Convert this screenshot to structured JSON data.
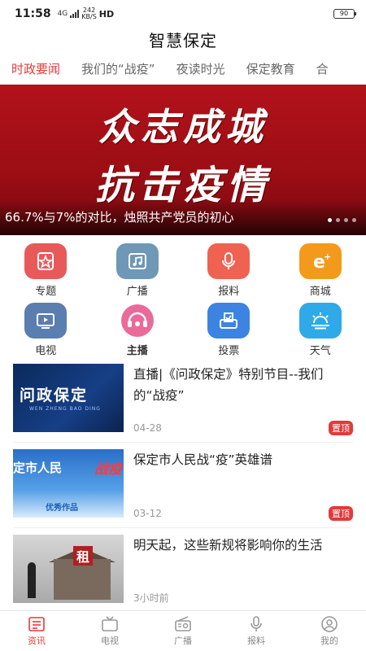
{
  "status_bar": {
    "time": "11:58",
    "network": "4G",
    "speed_value": "242",
    "speed_unit": "KB/S",
    "hd": "HD",
    "battery": "90"
  },
  "app": {
    "title": "智慧保定"
  },
  "tabs": [
    {
      "label": "时政要闻",
      "active": true
    },
    {
      "label": "我们的“战疫”"
    },
    {
      "label": "夜读时光"
    },
    {
      "label": "保定教育"
    },
    {
      "label": "合"
    }
  ],
  "banner": {
    "line1": "众志成城",
    "line2": "抗击疫情",
    "caption": "66.7%与7%的对比，烛照共产党员的初心"
  },
  "grid": [
    {
      "label": "专题",
      "icon": "star-doc-icon",
      "color": "#e85a5a"
    },
    {
      "label": "广播",
      "icon": "music-icon",
      "color": "#6f98b6"
    },
    {
      "label": "报料",
      "icon": "microphone-icon",
      "color": "#ef6252"
    },
    {
      "label": "商城",
      "icon": "e-shop-icon",
      "color": "#f39a1c"
    },
    {
      "label": "电视",
      "icon": "tv-icon",
      "color": "#5a7eb0"
    },
    {
      "label": "主播",
      "icon": "anchor-icon",
      "color": "#ea6a9a"
    },
    {
      "label": "投票",
      "icon": "vote-icon",
      "color": "#3d84e2"
    },
    {
      "label": "天气",
      "icon": "weather-icon",
      "color": "#2fa9e8"
    }
  ],
  "news": [
    {
      "title": "直播|《问政保定》特别节目--我们的“战疫”",
      "meta": "04-28",
      "pinned": "置顶",
      "thumb_big": "问政保定",
      "thumb_small": "WEN ZHENG BAO DING"
    },
    {
      "title": "保定市人民战“疫”英雄谱",
      "meta": "03-12",
      "pinned": "置顶",
      "thumb_a": "定市人民",
      "thumb_b": "战疫",
      "thumb_c": "优秀作品"
    },
    {
      "title": "明天起，这些新规将影响你的生活",
      "meta": "3小时前",
      "thumb_sign": "租"
    }
  ],
  "bottom_nav": [
    {
      "label": "资讯",
      "icon": "news-icon",
      "active": true
    },
    {
      "label": "电视",
      "icon": "tv-icon"
    },
    {
      "label": "广播",
      "icon": "radio-icon"
    },
    {
      "label": "报料",
      "icon": "microphone-icon"
    },
    {
      "label": "我的",
      "icon": "user-icon"
    }
  ],
  "colors": {
    "accent": "#e23a3a",
    "banner_red": "#b3121b"
  }
}
